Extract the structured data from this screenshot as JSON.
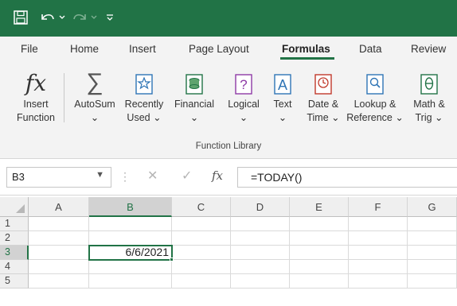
{
  "colors": {
    "accent": "#217346",
    "ribbon_bg": "#f3f3f3"
  },
  "quick_access": {
    "save_icon": "save-icon",
    "undo_icon": "undo-icon",
    "redo_icon": "redo-icon",
    "customize_icon": "customize-qat-icon"
  },
  "tabs": [
    {
      "label": "File"
    },
    {
      "label": "Home"
    },
    {
      "label": "Insert"
    },
    {
      "label": "Page Layout"
    },
    {
      "label": "Formulas",
      "active": true
    },
    {
      "label": "Data"
    },
    {
      "label": "Review"
    }
  ],
  "ribbon": {
    "insert_function": {
      "line1": "Insert",
      "line2": "Function"
    },
    "autosum": {
      "line1": "AutoSum",
      "line2": "⌄"
    },
    "recently_used": {
      "line1": "Recently",
      "line2": "Used ⌄"
    },
    "financial": {
      "line1": "Financial",
      "line2": "⌄"
    },
    "logical": {
      "line1": "Logical",
      "line2": "⌄"
    },
    "text": {
      "line1": "Text",
      "line2": "⌄"
    },
    "date_time": {
      "line1": "Date &",
      "line2": "Time ⌄"
    },
    "lookup": {
      "line1": "Lookup &",
      "line2": "Reference ⌄"
    },
    "math": {
      "line1": "Math &",
      "line2": "Trig ⌄"
    },
    "group_label": "Function Library"
  },
  "formula_bar": {
    "name_box": "B3",
    "cancel": "✕",
    "enter": "✓",
    "fx": "fx",
    "formula": "=TODAY()"
  },
  "grid": {
    "columns": [
      "A",
      "B",
      "C",
      "D",
      "E",
      "F",
      "G"
    ],
    "selected_column": "B",
    "rows": [
      "1",
      "2",
      "3",
      "4",
      "5"
    ],
    "selected_row": "3",
    "active_cell_value": "6/6/2021"
  }
}
